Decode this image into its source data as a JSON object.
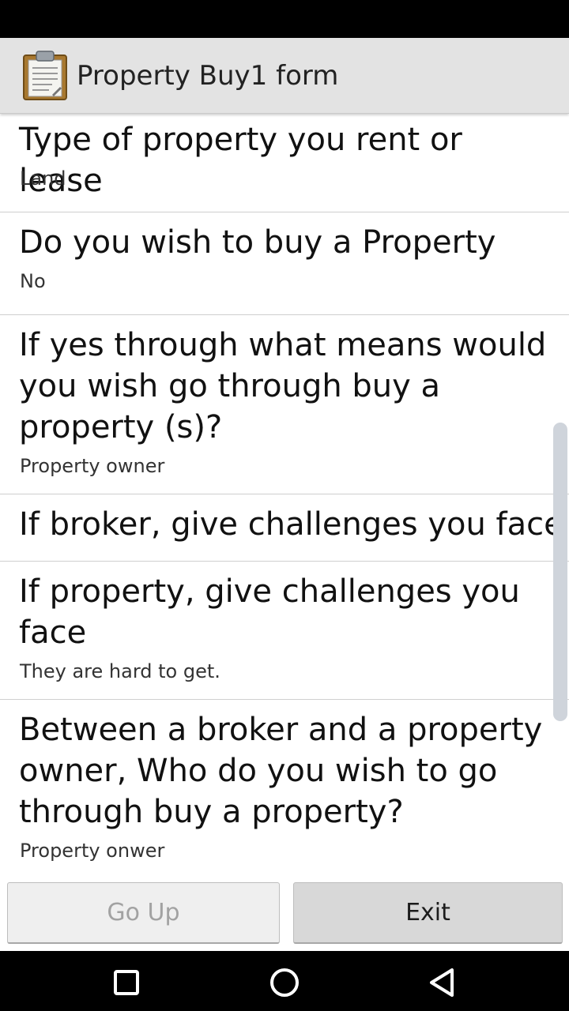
{
  "app_bar": {
    "title": "Property Buy1 form",
    "icon": "clipboard-icon"
  },
  "questions": [
    {
      "question": "Type of property you rent or lease",
      "answer": "Land"
    },
    {
      "question": "Do you wish to buy a Property",
      "answer": "No"
    },
    {
      "question": "If yes through what means would you wish go through buy a property (s)?",
      "answer": "Property owner"
    },
    {
      "question": "If broker, give challenges you face",
      "answer": ""
    },
    {
      "question": "If property, give challenges you face",
      "answer": "They are hard to get."
    },
    {
      "question": "Between a broker and a property owner, Who do you wish to go through buy a property?",
      "answer": "Property onwer"
    }
  ],
  "buttons": {
    "go_up": "Go Up",
    "exit": "Exit"
  },
  "nav_bar": {
    "icons": [
      "recent-apps-icon",
      "home-icon",
      "back-icon"
    ]
  },
  "colors": {
    "app_bar_bg": "#e3e3e3",
    "scrollbar": "#cfd4db",
    "divider": "#cfcfcf"
  }
}
